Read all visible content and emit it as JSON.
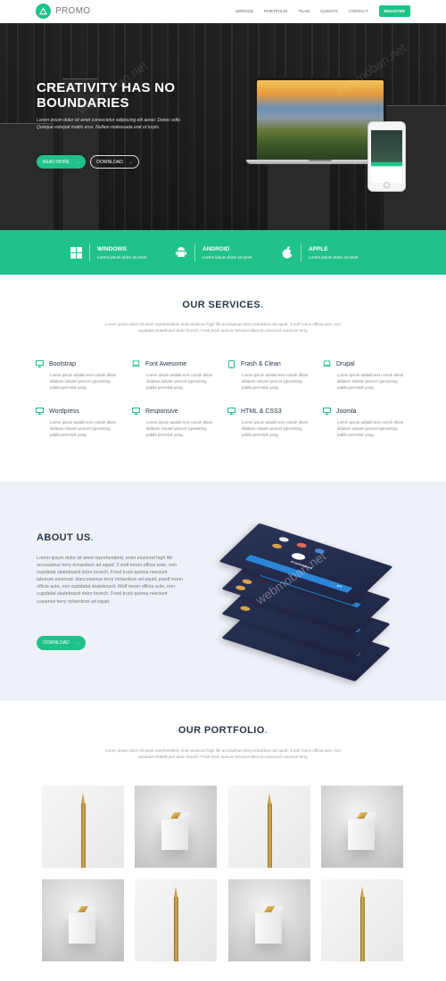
{
  "nav": {
    "brand": "PROMO",
    "links": [
      "SERVICE",
      "PORTFOLIO",
      "TEAM",
      "CLIENTS",
      "CONTACT"
    ],
    "register_label": "REGISTER"
  },
  "hero": {
    "title": "CREATIVITY HAS NO BOUNDARIES",
    "subtitle": "Lorem ipsum dolor sit amet consectetur adipiscing elit aenei. Donec odio. Quisque volutpat mattis eros. Nullam malesuada erat ut turpis.",
    "read_more_label": "READ MORE",
    "download_label": "DOWNLOAD"
  },
  "platforms": [
    {
      "name": "WINDOWS",
      "desc": "Lorem ipsum dolor sit amet",
      "icon": "windows-icon"
    },
    {
      "name": "ANDROID",
      "desc": "Lorem ipsum dolor sit amet",
      "icon": "android-icon"
    },
    {
      "name": "APPLE",
      "desc": "Lorem ipsum dolor sit amet",
      "icon": "apple-icon"
    }
  ],
  "services": {
    "title": "OUR SERVICES",
    "subtitle": "Lorem ipsum dolor sit amet reprehenderit, enim eiusmod high life accusamus terry richardson ad squid. 3 wolf moon officia aute, non cupidatat skateboard dolor brunch. Food truck quinoa nesciunt laborum eiusmod cusamus terry.",
    "items": [
      {
        "name": "Bootstrap",
        "desc": "Lorem ipsum adalah text contoh dikan didalam industri pencet typesetting pabila percetak yang."
      },
      {
        "name": "Font Awesome",
        "desc": "Lorem ipsum adalah text contoh dikan didalam industri pencet typesetting pabila percetak yang."
      },
      {
        "name": "Frash & Clean",
        "desc": "Lorem ipsum adalah text contoh dikan didalam industri pencet typesetting pabila percetak yang."
      },
      {
        "name": "Drupal",
        "desc": "Lorem ipsum adalah text contoh dikan didalam industri pencet typesetting pabila percetak yang."
      },
      {
        "name": "Wordpress",
        "desc": "Lorem ipsum adalah text contoh dikan didalam industri pencet typesetting pabila percetak yang."
      },
      {
        "name": "Responsive",
        "desc": "Lorem ipsum adalah text contoh dikan didalam industri pencet typesetting pabila percetak yang."
      },
      {
        "name": "HTML & CSS3",
        "desc": "Lorem ipsum adalah text contoh dikan didalam industri pencet typesetting pabila percetak yang."
      },
      {
        "name": "Joomla",
        "desc": "Lorem ipsum adalah text contoh dikan didalam industri pencet typesetting pabila percetak yang."
      }
    ]
  },
  "about": {
    "title": "ABOUT US",
    "text": "Lorem ipsum dolor sit amet reprehenderit, enim eiusmod high life accusamus terry richardson ad squid. 3 wolf moon officia aute, non cupidatat skateboard dolor brunch. Food truck quinoa nesciunt laborum eiusmod. Haccusamus terry richardson ad squid, pwolf moon officia aute, non cupidatat skateboard. Wolf moon officia aute, non cupidatat skateboard dolor brunch. Food truck quinoa nesciunt cusamus terry richardson ad squid.",
    "download_label": "DOWNLOAD",
    "screen_title": "Connect",
    "screen_value": "15"
  },
  "portfolio": {
    "title": "OUR PORTFOLIO",
    "subtitle": "Lorem ipsum dolor sit amet reprehenderit, enim eiusmod high life accusamus terry richardson ad squid. 3 wolf moon officia aute, non cupidatat skateboard dolor brunch. Food truck quinoa nesciunt laborum eiusmod cusamus terry.",
    "items": [
      "pencil",
      "cube",
      "pencil",
      "cube",
      "cube",
      "pencil",
      "cube",
      "pencil"
    ]
  },
  "watermark": "webmoban.net",
  "colors": {
    "accent": "#1fc288",
    "heading": "#2b3848",
    "about_bg": "#eef1f7"
  }
}
